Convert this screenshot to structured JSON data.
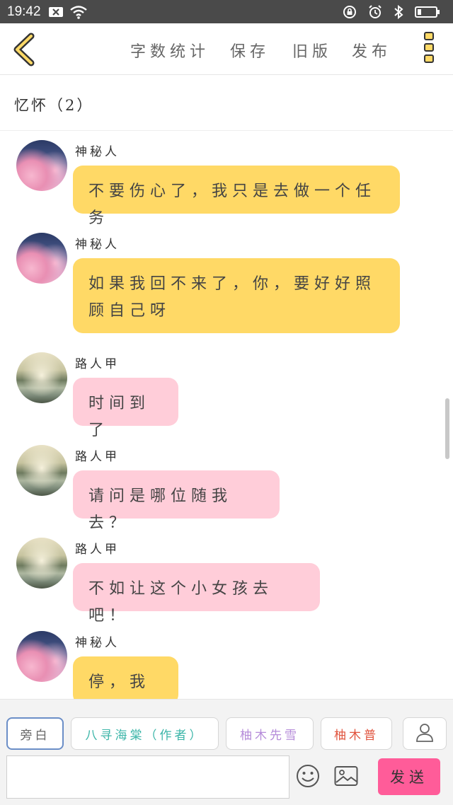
{
  "status_bar": {
    "time": "19:42",
    "icons": [
      "close-box-icon",
      "wifi-icon",
      "lock-rotation-icon",
      "alarm-icon",
      "bluetooth-icon",
      "battery-icon"
    ]
  },
  "toolbar": {
    "back_icon": "chevron-left-icon",
    "word_count_label": "字数统计",
    "save_label": "保存",
    "old_version_label": "旧版",
    "publish_label": "发布",
    "menu_icon": "more-vertical-icon"
  },
  "chapter": {
    "title": "忆怀（2）"
  },
  "messages": [
    {
      "sender": "神秘人",
      "text": "不要伤心了，我只是去做一个任务",
      "bubble_color": "#ffd966",
      "avatar": "night-sky"
    },
    {
      "sender": "神秘人",
      "text": "如果我回不来了，你，要好好照顾自己呀",
      "bubble_color": "#ffd966",
      "avatar": "night-sky"
    },
    {
      "sender": "路人甲",
      "text": "时间到了",
      "bubble_color": "#ffcdd9",
      "avatar": "landscape"
    },
    {
      "sender": "路人甲",
      "text": "请问是哪位随我去？",
      "bubble_color": "#ffcdd9",
      "avatar": "landscape"
    },
    {
      "sender": "路人甲",
      "text": "不如让这个小女孩去吧！",
      "bubble_color": "#ffcdd9",
      "avatar": "landscape"
    },
    {
      "sender": "神秘人",
      "text": "停，我去",
      "bubble_color": "#ffd966",
      "avatar": "night-sky"
    }
  ],
  "roles": [
    {
      "label": "旁白",
      "color": "#666666",
      "selected": true
    },
    {
      "label": "八寻海棠（作者）",
      "color": "#3bb5a8",
      "selected": false
    },
    {
      "label": "柚木先雪",
      "color": "#b58bd9",
      "selected": false
    },
    {
      "label": "柚木普",
      "color": "#e0533d",
      "selected": false
    }
  ],
  "composer": {
    "placeholder": "",
    "emoji_icon": "emoji-icon",
    "image_icon": "image-icon",
    "send_label": "发送"
  },
  "colors": {
    "accent_yellow": "#ffd966",
    "accent_pink": "#ffcdd9",
    "send_button": "#ff5c99"
  }
}
